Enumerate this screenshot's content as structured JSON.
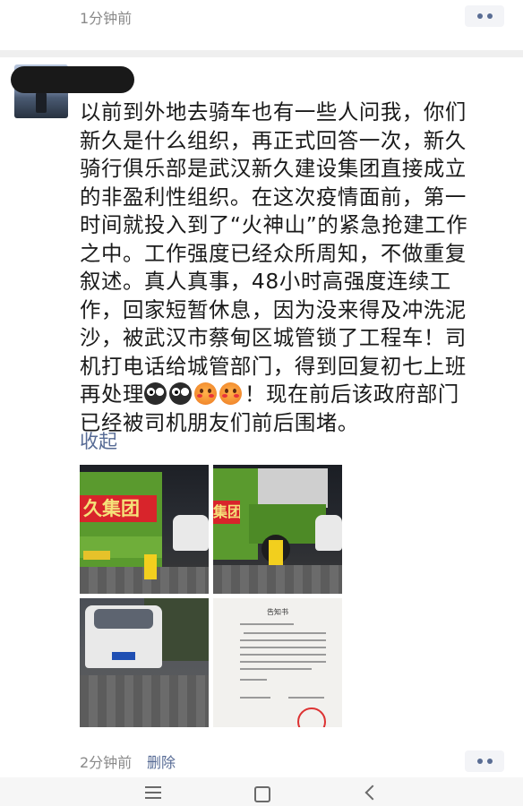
{
  "top": {
    "time": "1分钟前"
  },
  "post": {
    "lines": [
      "以前到外地去骑车也有一些人问我，你们",
      "新久是什么组织，再正式回答一次，新久",
      "骑行俱乐部是武汉新久建设集团直接成立",
      "的非盈利性组织。在这次疫情面前，第一",
      "时间就投入到了“火神山”的紧急抢建工作",
      "之中。工作强度已经众所周知，不做重复",
      "叙述。真人真事，48小时高强度连续工",
      "作，回家短暂休息，因为没来得及冲洗泥",
      "沙，被武汉市蔡甸区城管锁了工程车！司",
      "机打电话给城管部门，得到回复初七上班"
    ],
    "line_before_emoji": "再处理",
    "line_after_emoji": "！现在前后该政府部门",
    "last_line": "已经被司机朋友们前后围堵。",
    "emoji_icons": [
      "owl-emoji-icon",
      "owl-emoji-icon",
      "flushed-emoji-icon",
      "flushed-emoji-icon"
    ],
    "collapse_label": "收起"
  },
  "photos": {
    "sign_text_1": "久集团",
    "sign_text_2": "集团",
    "doc_title": "告知书"
  },
  "footer": {
    "time": "2分钟前",
    "delete_label": "删除"
  },
  "nav": {
    "icons": [
      "menu-icon",
      "home-icon",
      "back-icon"
    ]
  },
  "colors": {
    "link": "#576b95",
    "meta": "#8a8a8a",
    "text": "#1a1a1a"
  }
}
